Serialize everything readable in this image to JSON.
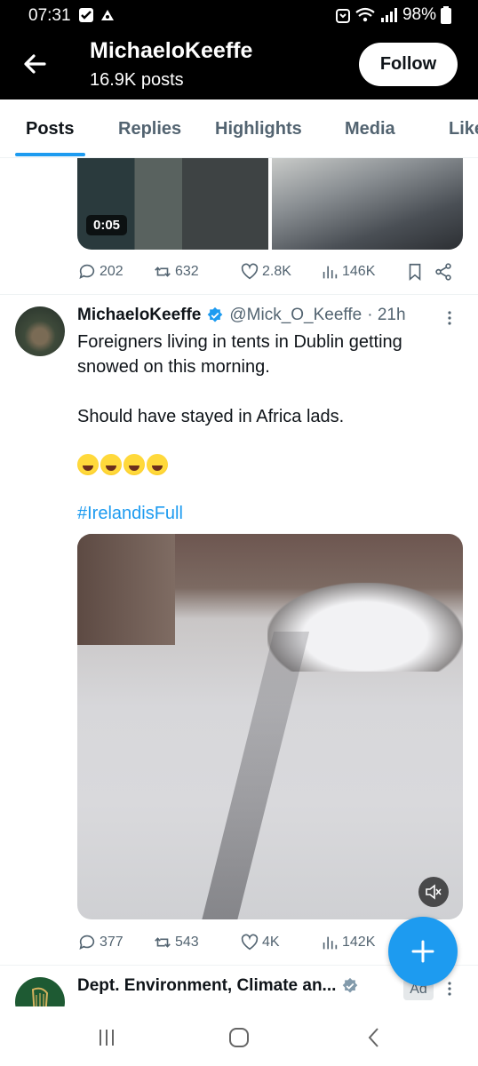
{
  "status_bar": {
    "time": "07:31",
    "battery": "98%"
  },
  "header": {
    "name": "MichaeloKeeffe",
    "post_count": "16.9K posts",
    "follow_label": "Follow"
  },
  "tabs": [
    {
      "label": "Posts",
      "active": true
    },
    {
      "label": "Replies",
      "active": false
    },
    {
      "label": "Highlights",
      "active": false
    },
    {
      "label": "Media",
      "active": false
    },
    {
      "label": "Like",
      "active": false
    }
  ],
  "prev_tweet": {
    "video_duration": "0:05",
    "stats": {
      "replies": "202",
      "reposts": "632",
      "likes": "2.8K",
      "views": "146K"
    }
  },
  "tweet": {
    "name": "MichaeloKeeffe",
    "handle": "@Mick_O_Keeffe",
    "time": "· 21h",
    "line1": "Foreigners living in tents in Dublin getting snowed on this morning.",
    "line2": "Should have stayed in Africa lads.",
    "hashtag": "#IrelandisFull",
    "stats": {
      "replies": "377",
      "reposts": "543",
      "likes": "4K",
      "views": "142K"
    }
  },
  "ad_tweet": {
    "name": "Dept. Environment, Climate an...",
    "badge": "Ad"
  },
  "colors": {
    "accent": "#1d9bf0",
    "header_bg": "#000000",
    "muted_text": "#536471"
  }
}
